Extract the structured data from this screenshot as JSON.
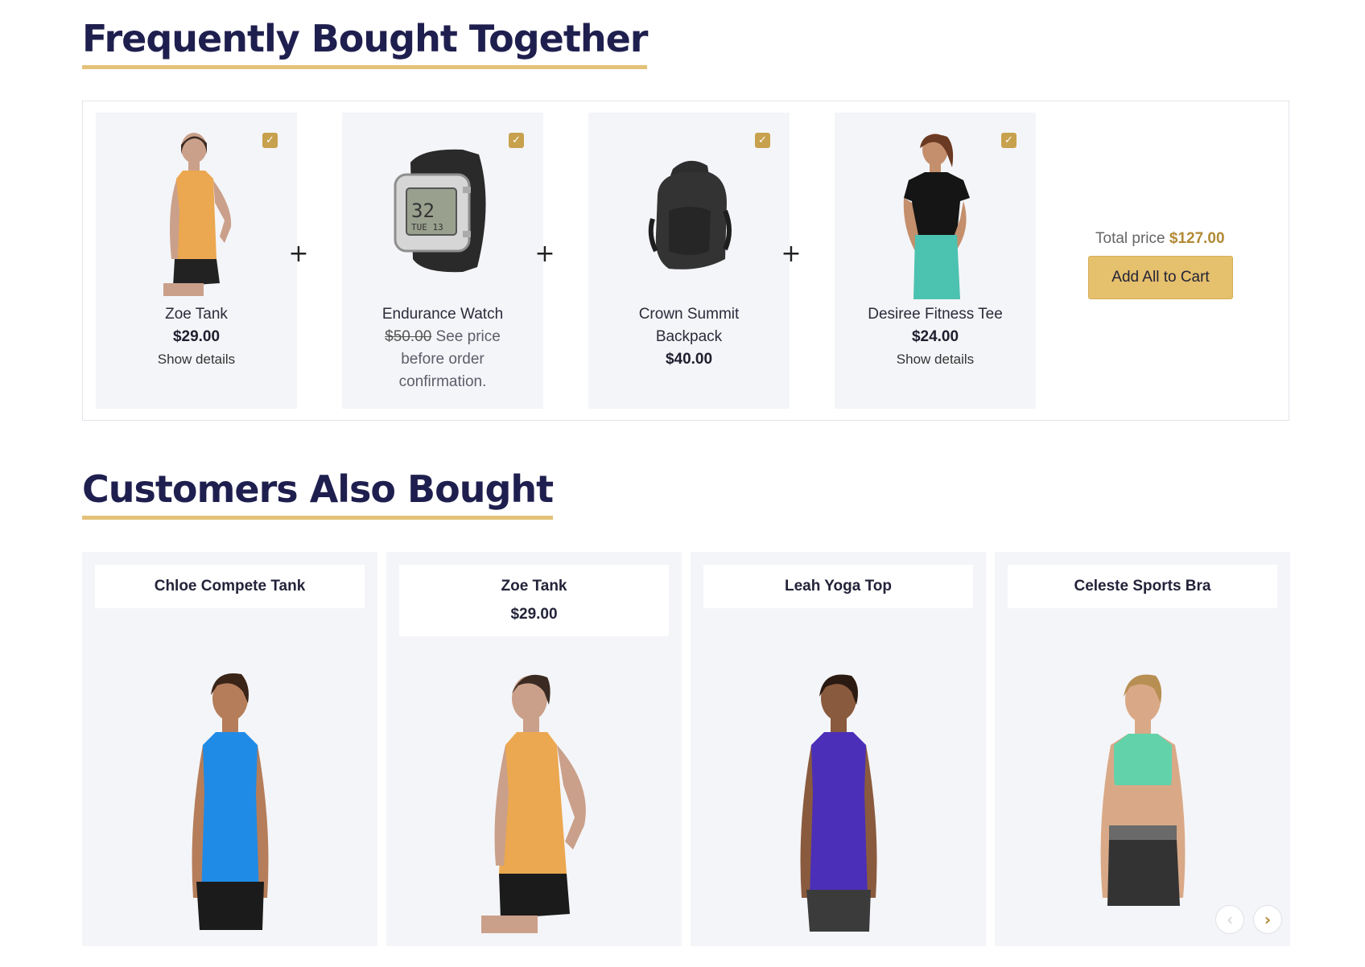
{
  "fbt": {
    "title": "Frequently Bought Together",
    "items": [
      {
        "name": "Zoe Tank",
        "price": "$29.00",
        "details": "Show details",
        "checked": true
      },
      {
        "name": "Endurance Watch",
        "old_price": "$50.00",
        "note_a": " See price",
        "note_b": "before order",
        "note_c": "confirmation.",
        "checked": true
      },
      {
        "name_a": "Crown Summit",
        "name_b": "Backpack",
        "price": "$40.00",
        "checked": true
      },
      {
        "name": "Desiree Fitness Tee",
        "price": "$24.00",
        "details": "Show details",
        "checked": true
      }
    ],
    "plus": "+",
    "check": "✓",
    "total_label": "Total price ",
    "total_value": "$127.00",
    "add_all_label": "Add All to Cart"
  },
  "cab": {
    "title": "Customers Also Bought",
    "items": [
      {
        "name": "Chloe Compete Tank"
      },
      {
        "name": "Zoe Tank",
        "price": "$29.00"
      },
      {
        "name": "Leah Yoga Top"
      },
      {
        "name": "Celeste Sports Bra"
      }
    ],
    "prev_icon": "‹",
    "next_icon": "›"
  },
  "colors": {
    "heading": "#1f1f4f",
    "accent": "#e3c27a",
    "check": "#c7a14d",
    "total": "#b28a35",
    "card_bg": "#f4f5f8"
  }
}
